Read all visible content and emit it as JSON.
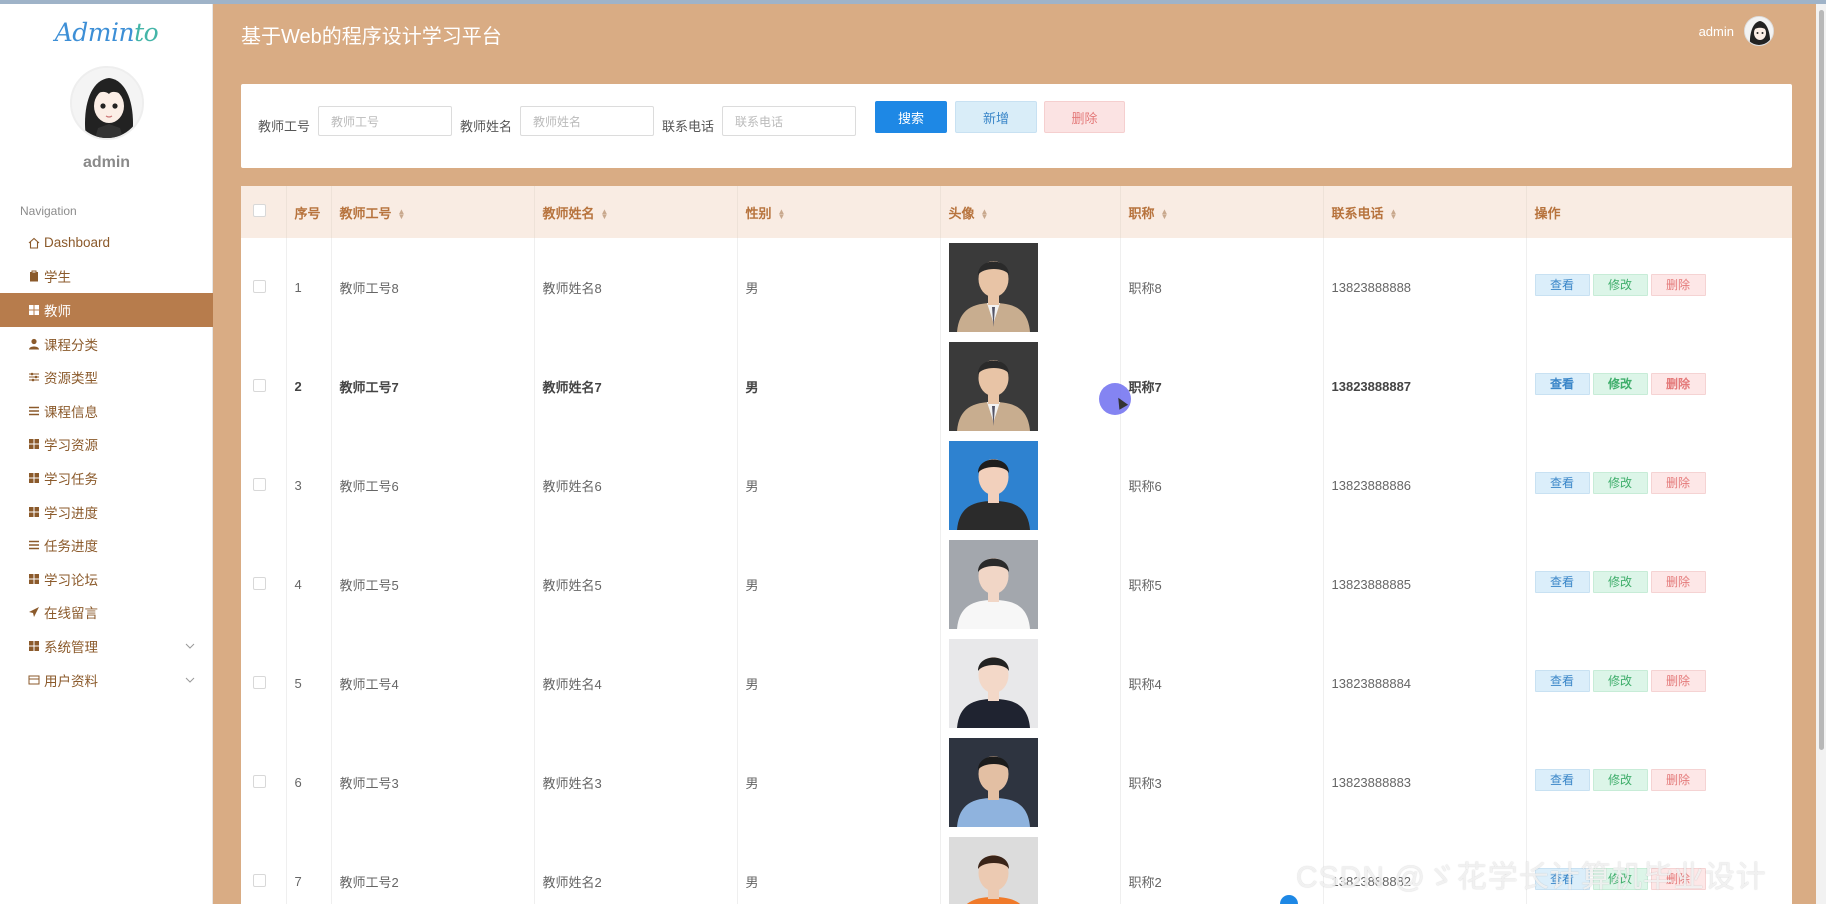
{
  "brand": {
    "logo_main": "Admin",
    "logo_tail": "to"
  },
  "sidebar": {
    "user": "admin",
    "nav_title": "Navigation",
    "items": [
      {
        "label": "Dashboard",
        "icon": "home-icon"
      },
      {
        "label": "学生",
        "icon": "clipboard-icon"
      },
      {
        "label": "教师",
        "icon": "grid-icon",
        "active": true
      },
      {
        "label": "课程分类",
        "icon": "user-icon"
      },
      {
        "label": "资源类型",
        "icon": "sliders-icon"
      },
      {
        "label": "课程信息",
        "icon": "list-icon"
      },
      {
        "label": "学习资源",
        "icon": "grid-icon"
      },
      {
        "label": "学习任务",
        "icon": "grid-icon"
      },
      {
        "label": "学习进度",
        "icon": "grid-icon"
      },
      {
        "label": "任务进度",
        "icon": "list-icon"
      },
      {
        "label": "学习论坛",
        "icon": "grid-icon"
      },
      {
        "label": "在线留言",
        "icon": "send-icon"
      },
      {
        "label": "系统管理",
        "icon": "grid-icon",
        "expandable": true
      },
      {
        "label": "用户资料",
        "icon": "card-icon",
        "expandable": true
      }
    ]
  },
  "header": {
    "title": "基于Web的程序设计学习平台",
    "user": "admin"
  },
  "search": {
    "teacher_no_label": "教师工号",
    "teacher_no_placeholder": "教师工号",
    "teacher_name_label": "教师姓名",
    "teacher_name_placeholder": "教师姓名",
    "phone_label": "联系电话",
    "phone_placeholder": "联系电话",
    "search_btn": "搜索",
    "add_btn": "新增",
    "delete_btn": "删除"
  },
  "table": {
    "headers": {
      "index": "序号",
      "teacher_no": "教师工号",
      "teacher_name": "教师姓名",
      "gender": "性别",
      "avatar": "头像",
      "title": "职称",
      "phone": "联系电话",
      "actions": "操作"
    },
    "actions": {
      "view": "查看",
      "edit": "修改",
      "delete": "删除"
    },
    "rows": [
      {
        "index": "1",
        "teacher_no": "教师工号8",
        "teacher_name": "教师姓名8",
        "gender": "男",
        "title": "职称8",
        "phone": "13823888888"
      },
      {
        "index": "2",
        "teacher_no": "教师工号7",
        "teacher_name": "教师姓名7",
        "gender": "男",
        "title": "职称7",
        "phone": "13823888887"
      },
      {
        "index": "3",
        "teacher_no": "教师工号6",
        "teacher_name": "教师姓名6",
        "gender": "男",
        "title": "职称6",
        "phone": "13823888886"
      },
      {
        "index": "4",
        "teacher_no": "教师工号5",
        "teacher_name": "教师姓名5",
        "gender": "男",
        "title": "职称5",
        "phone": "13823888885"
      },
      {
        "index": "5",
        "teacher_no": "教师工号4",
        "teacher_name": "教师姓名4",
        "gender": "男",
        "title": "职称4",
        "phone": "13823888884"
      },
      {
        "index": "6",
        "teacher_no": "教师工号3",
        "teacher_name": "教师姓名3",
        "gender": "男",
        "title": "职称3",
        "phone": "13823888883"
      },
      {
        "index": "7",
        "teacher_no": "教师工号2",
        "teacher_name": "教师姓名2",
        "gender": "男",
        "title": "职称2",
        "phone": "13823888882"
      }
    ]
  },
  "watermark": "CSDN @ゞ花学长计算机毕业设计",
  "colors": {
    "accent": "#b77c4c",
    "header_bg": "#d9ac84",
    "primary": "#1e88e5"
  }
}
